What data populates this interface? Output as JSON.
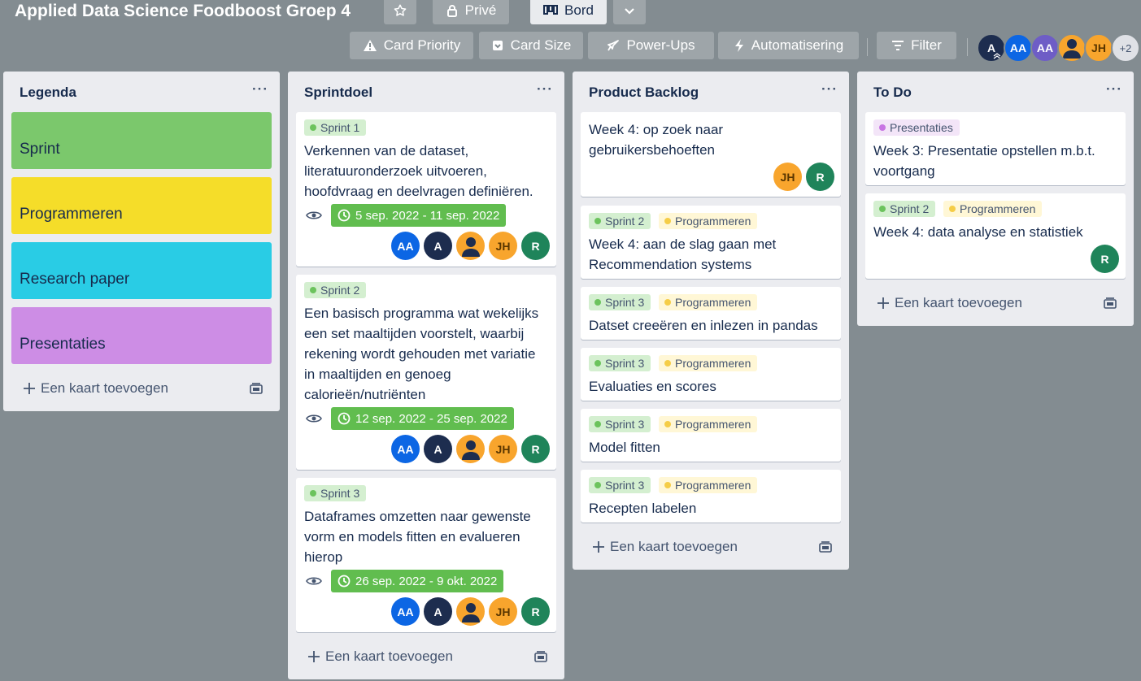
{
  "board": {
    "title": "Applied Data Science Foodboost Groep 4",
    "visibility_label": "Privé",
    "view_label": "Bord"
  },
  "toolbar": {
    "card_priority": "Card Priority",
    "card_size": "Card Size",
    "power_ups": "Power-Ups",
    "automation": "Automatisering",
    "filter": "Filter"
  },
  "members": {
    "avatars": [
      "A",
      "AA",
      "AA",
      "",
      "JH"
    ],
    "more": "+2"
  },
  "colors": {
    "sprint": "#7bc86c",
    "programmeren": "#f5dd29",
    "research": "#29cce5",
    "presentaties": "#cd8de5",
    "date_badge": "#61bd4f"
  },
  "lists": {
    "legend": {
      "title": "Legenda",
      "menu": "···",
      "items": [
        "Sprint",
        "Programmeren",
        "Research paper",
        "Presentaties"
      ],
      "add_card": "Een kaart toevoegen"
    },
    "sprintdoel": {
      "title": "Sprintdoel",
      "menu": "···",
      "cards": [
        {
          "labels": [
            "Sprint 1"
          ],
          "text": "Verkennen van de dataset, literatuuronderzoek uitvoeren, hoofdvraag en deelvragen definiëren.",
          "date": "5 sep. 2022 - 11 sep. 2022",
          "members": [
            "AA",
            "A",
            "",
            "JH",
            "R"
          ]
        },
        {
          "labels": [
            "Sprint 2"
          ],
          "text": "Een basisch programma wat wekelijks een set maaltijden voorstelt, waarbij rekening wordt gehouden met variatie in maaltijden en genoeg calorieën/nutriënten",
          "date": "12 sep. 2022 - 25 sep. 2022",
          "members": [
            "AA",
            "A",
            "",
            "JH",
            "R"
          ]
        },
        {
          "labels": [
            "Sprint 3"
          ],
          "text": "Dataframes omzetten naar gewenste vorm en models fitten en evalueren hierop",
          "date": "26 sep. 2022 - 9 okt. 2022",
          "members": [
            "AA",
            "A",
            "",
            "JH",
            "R"
          ]
        }
      ],
      "add_card": "Een kaart toevoegen"
    },
    "backlog": {
      "title": "Product Backlog",
      "menu": "···",
      "cards": [
        {
          "labels": [],
          "text": "Week 4: op zoek naar gebruikersbehoeften",
          "members": [
            "JH",
            "R"
          ]
        },
        {
          "labels": [
            "Sprint 2",
            "Programmeren"
          ],
          "text": "Week 4: aan de slag gaan met Recommendation systems"
        },
        {
          "labels": [
            "Sprint 3",
            "Programmeren"
          ],
          "text": "Datset creeëren en inlezen in pandas"
        },
        {
          "labels": [
            "Sprint 3",
            "Programmeren"
          ],
          "text": "Evaluaties en scores"
        },
        {
          "labels": [
            "Sprint 3",
            "Programmeren"
          ],
          "text": "Model fitten"
        },
        {
          "labels": [
            "Sprint 3",
            "Programmeren"
          ],
          "text": "Recepten labelen"
        }
      ],
      "add_card": "Een kaart toevoegen"
    },
    "todo": {
      "title": "To Do",
      "menu": "···",
      "cards": [
        {
          "labels": [
            "Presentaties"
          ],
          "text": "Week 3: Presentatie opstellen m.b.t. voortgang"
        },
        {
          "labels": [
            "Sprint 2",
            "Programmeren"
          ],
          "text": "Week 4: data analyse en statistiek",
          "members": [
            "R"
          ]
        }
      ],
      "add_card": "Een kaart toevoegen"
    }
  }
}
